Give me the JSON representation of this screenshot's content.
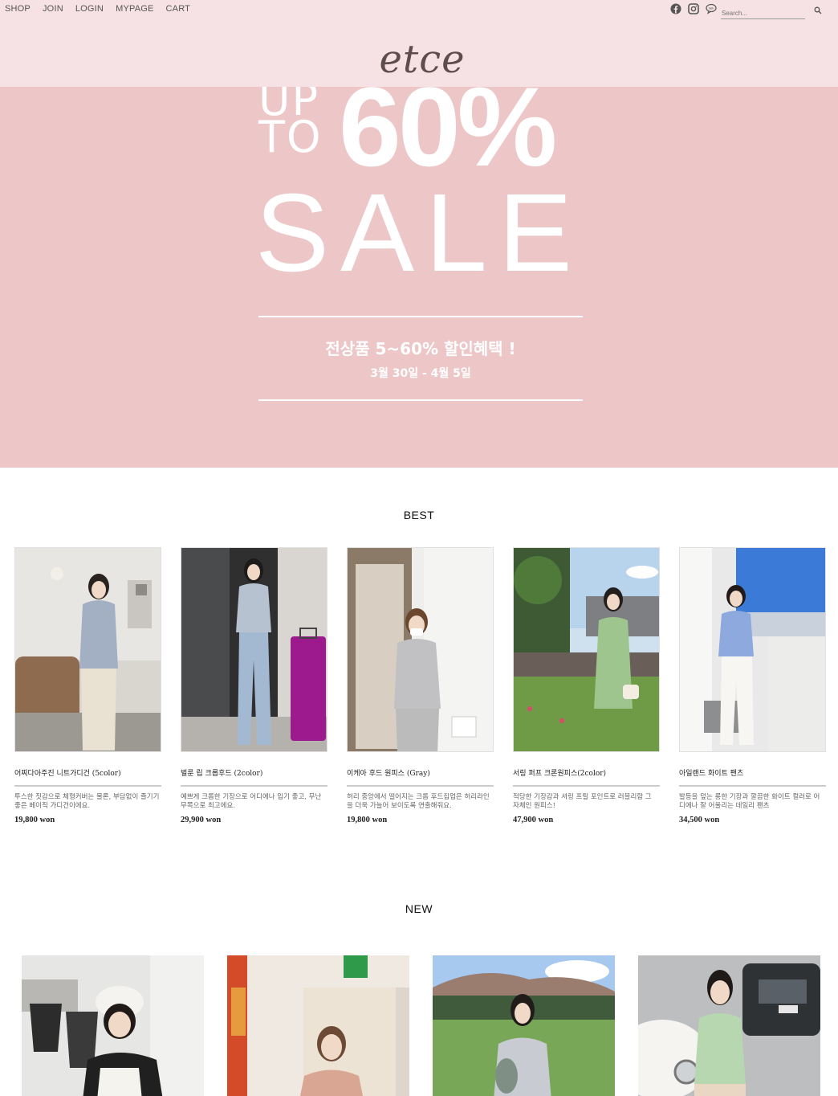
{
  "topnav": {
    "items": [
      "SHOP",
      "JOIN",
      "LOGIN",
      "MYPAGE",
      "CART"
    ]
  },
  "social": {
    "icons": [
      "facebook-icon",
      "instagram-icon",
      "talk-icon"
    ]
  },
  "search": {
    "placeholder": "Search...",
    "icon": "search-icon"
  },
  "brand": {
    "logo": "etce"
  },
  "hero": {
    "up": "UP",
    "to": "TO",
    "percent": "60%",
    "sale": "SALE",
    "headline": "전상품 5~60% 할인혜택 !",
    "period": "3월 30일 - 4월 5일",
    "background": "#edc7c8"
  },
  "best": {
    "title": "BEST",
    "products": [
      {
        "name": "어찌다아주진 니트가디건 (5color)",
        "desc": "투스한 짓감으로 체형커버는 물론, 부담없이 즐기기 좋은 베이직 가디건이에요.",
        "price": "19,800 won"
      },
      {
        "name": "벌룬 립 크롭후드 (2color)",
        "desc": "예쁘게 크롭한 기장으로 어디에나 입기 좋고, 무난무쪽으로 최고에요.",
        "price": "29,900 won"
      },
      {
        "name": "이케아 후드 원피스 (Gray)",
        "desc": "허리 중앙에서 떨어지는 크롭 후드집업은 허리라인을 더욱 가늘어 보이도록 연출해줘요.",
        "price": "19,800 won"
      },
      {
        "name": "서링 퍼프 크론원피스(2color)",
        "desc": "적당한 기장감과 셔링 프릴 포인트로 러블리함 그 자체인 원피스!",
        "price": "47,900 won"
      },
      {
        "name": "아일랜드 화이트 팬츠",
        "desc": "발등을 덮는 롱한 기장과 깔끔한 화이트 컬러로 어디에나 잘 어울리는 데일리 팬츠",
        "price": "34,500 won"
      }
    ]
  },
  "new": {
    "title": "NEW",
    "products": [
      "new-product-1",
      "new-product-2",
      "new-product-3",
      "new-product-4"
    ]
  }
}
